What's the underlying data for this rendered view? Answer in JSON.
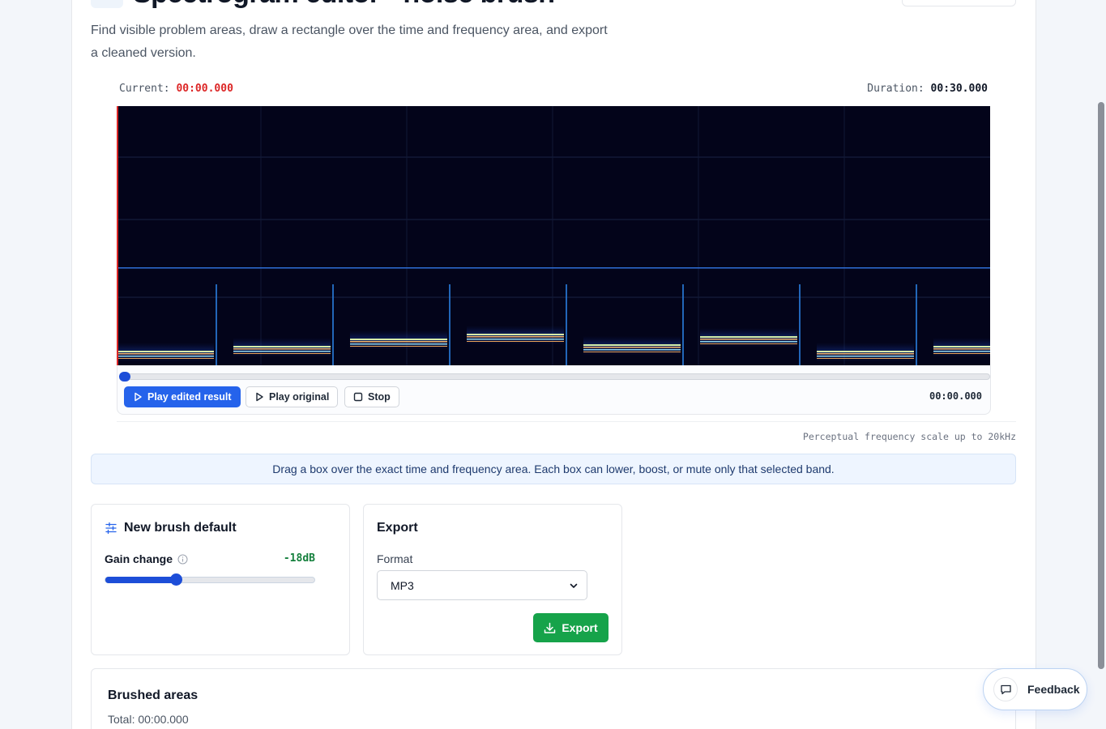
{
  "header": {
    "title": "Spectrogram editor · noise brush",
    "subtitle": "Find visible problem areas, draw a rectangle over the time and frequency area, and export a cleaned version."
  },
  "timeline": {
    "current_label": "Current:",
    "current_value": "00:00.000",
    "duration_label": "Duration:",
    "duration_value": "00:30.000",
    "playhead_progress": 0.0
  },
  "player": {
    "play_edited_label": "Play edited result",
    "play_original_label": "Play original",
    "stop_label": "Stop",
    "position_readout": "00:00.000"
  },
  "scale_note": "Perceptual frequency scale up to 20kHz",
  "info_banner": "Drag a box over the exact time and frequency area. Each box can lower, boost, or mute only that selected band.",
  "brush_panel": {
    "title": "New brush default",
    "gain_label": "Gain change",
    "gain_value": "-18dB",
    "gain_db": -18,
    "gain_min_db": -60,
    "gain_max_db": 60,
    "slider_fraction": 0.34
  },
  "export_panel": {
    "title": "Export",
    "format_label": "Format",
    "format_selected": "MP3",
    "export_label": "Export"
  },
  "brushed_areas": {
    "title": "Brushed areas",
    "total": "Total: 00:00.000"
  },
  "feedback": {
    "label": "Feedback"
  },
  "colors": {
    "accent": "#2563eb",
    "success": "#16a34a",
    "current_time": "#dc2626",
    "gain_value": "#15803d",
    "spectrogram_bg": "#03041a"
  },
  "icons": {
    "play": "play-icon",
    "stop": "stop-icon",
    "sliders": "sliders-icon",
    "info": "info-icon",
    "download": "download-icon",
    "chevron": "chevron-down-icon",
    "feedback": "message-icon"
  }
}
